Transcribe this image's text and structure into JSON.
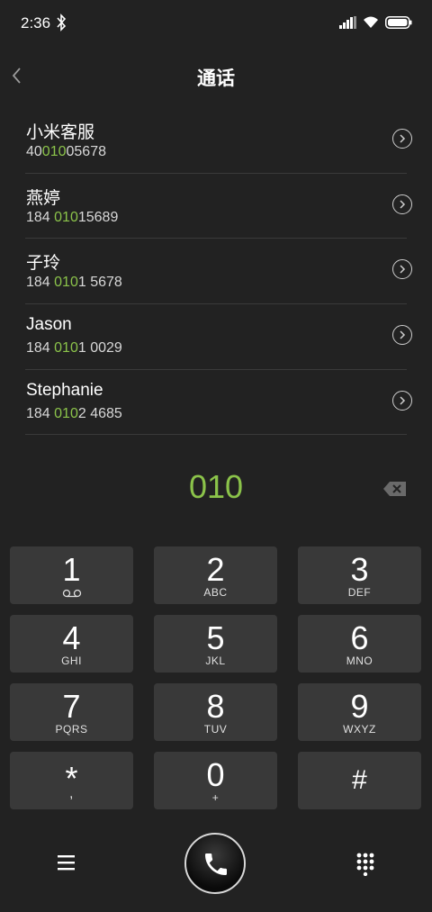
{
  "status_bar": {
    "time": "2:36",
    "icons": [
      "bluetooth-icon",
      "signal-icon",
      "wifi-icon",
      "battery-icon"
    ]
  },
  "header": {
    "title": "通话",
    "back_icon": "chevron-left-icon"
  },
  "contacts": [
    {
      "name": "小米客服",
      "number_pre": "40",
      "number_match": "010",
      "number_post": "05678"
    },
    {
      "name": "燕婷",
      "number_pre": "184 ",
      "number_match": "010",
      "number_post": "15689"
    },
    {
      "name": "子玲",
      "number_pre": "184 ",
      "number_match": "010",
      "number_post": "1 5678"
    },
    {
      "name": "Jason",
      "number_pre": "184 ",
      "number_match": "010",
      "number_post": "1 0029"
    },
    {
      "name": "Stephanie",
      "number_pre": "184 ",
      "number_match": "010",
      "number_post": "2 4685"
    }
  ],
  "dialed_number": "010",
  "keypad": {
    "keys": [
      {
        "digit": "1",
        "letters": ""
      },
      {
        "digit": "2",
        "letters": "ABC"
      },
      {
        "digit": "3",
        "letters": "DEF"
      },
      {
        "digit": "4",
        "letters": "GHI"
      },
      {
        "digit": "5",
        "letters": "JKL"
      },
      {
        "digit": "6",
        "letters": "MNO"
      },
      {
        "digit": "7",
        "letters": "PQRS"
      },
      {
        "digit": "8",
        "letters": "TUV"
      },
      {
        "digit": "9",
        "letters": "WXYZ"
      },
      {
        "digit": "*",
        "letters": ","
      },
      {
        "digit": "0",
        "letters": "+"
      },
      {
        "digit": "#",
        "letters": ""
      }
    ]
  },
  "colors": {
    "background": "#222222",
    "key_background": "#393939",
    "accent": "#8bc34a"
  },
  "bottom_bar": {
    "icons": [
      "menu-icon",
      "phone-icon",
      "dialpad-icon"
    ]
  }
}
